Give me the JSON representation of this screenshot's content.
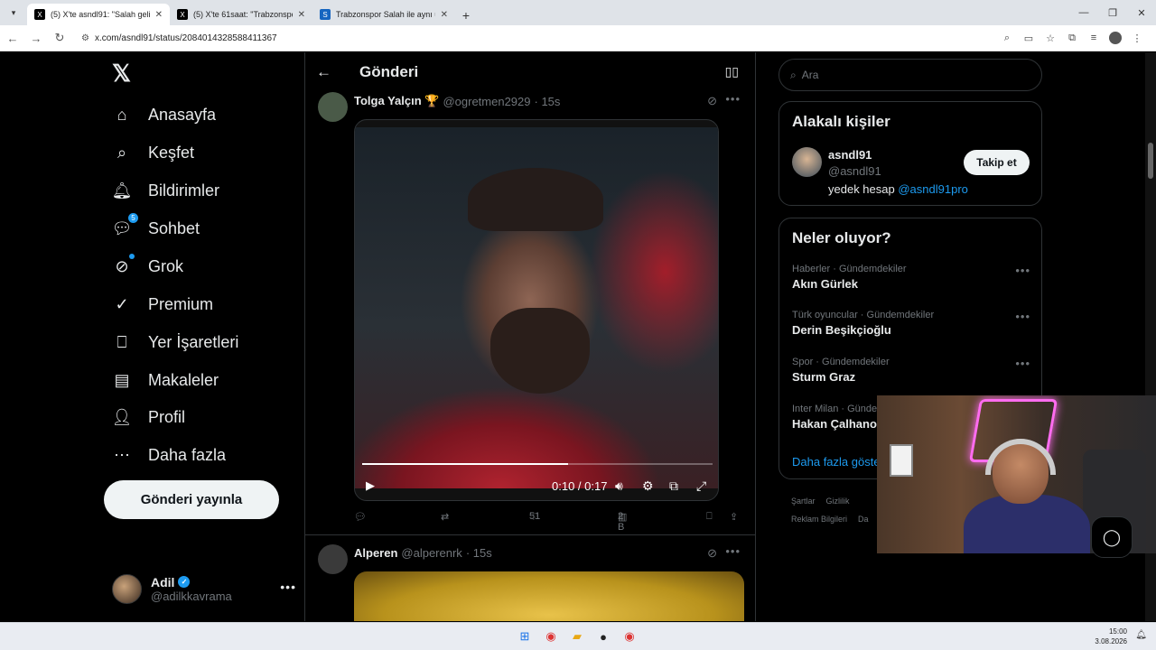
{
  "browser": {
    "tabs": [
      {
        "title": "(5) X'te asndl91: \"Salah gelirse",
        "active": true
      },
      {
        "title": "(5) X'te 61saat: \"Trabzonspor Sa",
        "active": false
      },
      {
        "title": "Trabzonspor Salah ile aynı uçak",
        "active": false
      }
    ],
    "url": "x.com/asndl91/status/2084014328588411367"
  },
  "x": {
    "nav": [
      {
        "label": "Anasayfa",
        "icon": "home-icon"
      },
      {
        "label": "Keşfet",
        "icon": "search-icon"
      },
      {
        "label": "Bildirimler",
        "icon": "bell-icon"
      },
      {
        "label": "Sohbet",
        "icon": "chat-icon",
        "badge": "5"
      },
      {
        "label": "Grok",
        "icon": "grok-icon"
      },
      {
        "label": "Premium",
        "icon": "premium-icon"
      },
      {
        "label": "Yer İşaretleri",
        "icon": "bookmark-icon"
      },
      {
        "label": "Makaleler",
        "icon": "article-icon"
      },
      {
        "label": "Profil",
        "icon": "profile-icon"
      },
      {
        "label": "Daha fazla",
        "icon": "more-circle-icon"
      }
    ],
    "post_button": "Gönderi yayınla",
    "me": {
      "name": "Adil",
      "handle": "@adilkkavrama"
    },
    "header_title": "Gönderi",
    "posts": [
      {
        "name": "Tolga Yalçın 🏆",
        "handle": "@ogretmen2929",
        "time": "· 15s",
        "video_time": "0:10 / 0:17",
        "video_progress": 0.588,
        "likes": "51",
        "views": "2 B"
      },
      {
        "name": "Alperen",
        "handle": "@alperenrk",
        "time": "· 15s"
      }
    ],
    "search_placeholder": "Ara",
    "related": {
      "title": "Alakalı kişiler",
      "name": "asndl91",
      "handle": "@asndl91",
      "bio_prefix": "yedek hesap",
      "bio_link": "@asndl91pro",
      "follow_label": "Takip et"
    },
    "trends": {
      "title": "Neler oluyor?",
      "items": [
        {
          "category": "Haberler · Gündemdekiler",
          "topic": "Akın Gürlek"
        },
        {
          "category": "Türk oyuncular · Gündemdekiler",
          "topic": "Derin Beşikçioğlu"
        },
        {
          "category": "Spor · Gündemdekiler",
          "topic": "Sturm Graz"
        },
        {
          "category": "Inter Milan · Günde",
          "topic": "Hakan Çalhanoğ"
        }
      ],
      "show_more": "Daha fazla göste"
    },
    "footer": {
      "row1": [
        "Şartlar",
        "Gizlilik"
      ],
      "row2": [
        "Reklam Bilgileri",
        "Da"
      ]
    }
  },
  "taskbar": {
    "time": "15:00",
    "date": "3.08.2026"
  },
  "colors": {
    "accent": "#1d9bf0",
    "background": "#000000",
    "border": "#2f3336"
  }
}
